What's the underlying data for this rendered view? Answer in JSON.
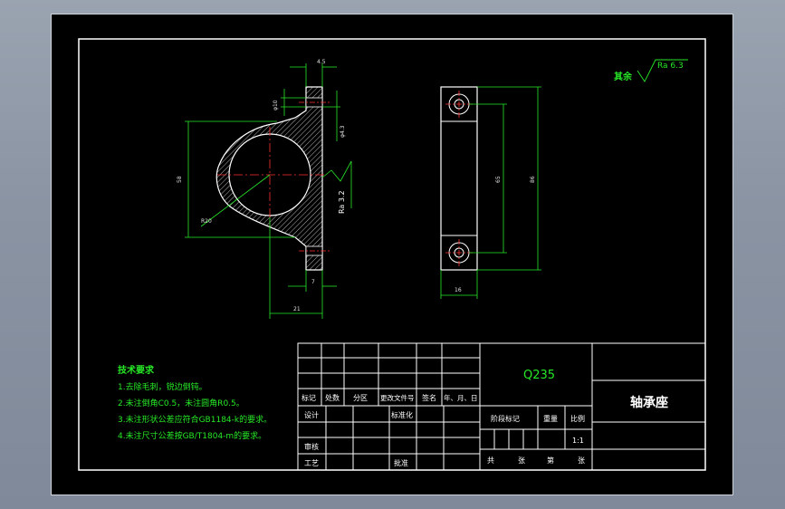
{
  "roughness": {
    "label": "其余",
    "value": "Ra 6.3"
  },
  "front_view": {
    "dim_top_slot": "4.5",
    "dim_bolt_dia": "φ10",
    "dim_hole_dia": "φ4.3",
    "dim_height": "58",
    "dim_radius": "R20",
    "dim_surface": "Ra 3.2",
    "dim_bottom": "7",
    "dim_width": "21"
  },
  "side_view": {
    "dim_hole_spacing": "65",
    "dim_height": "86",
    "dim_width": "16"
  },
  "tech_requirements": {
    "title": "技术要求",
    "items": [
      "1.去除毛刺，锐边倒钝。",
      "2.未注倒角C0.5，未注圆角R0.5。",
      "3.未注形状公差应符合GB1184-k的要求。",
      "4.未注尺寸公差按GB/T1804-m的要求。"
    ]
  },
  "title_block": {
    "material": "Q235",
    "part_name": "轴承座",
    "headers": [
      "标记",
      "处数",
      "分区",
      "更改文件号",
      "签名",
      "年、月、日"
    ],
    "design": "设计",
    "standardization": "标准化",
    "review": "审核",
    "process": "工艺",
    "approve": "批准",
    "stage_mark": "阶段标记",
    "weight": "重量",
    "scale_label": "比例",
    "scale_value": "1:1",
    "sheets": [
      "共",
      "张",
      "第",
      "张"
    ]
  }
}
